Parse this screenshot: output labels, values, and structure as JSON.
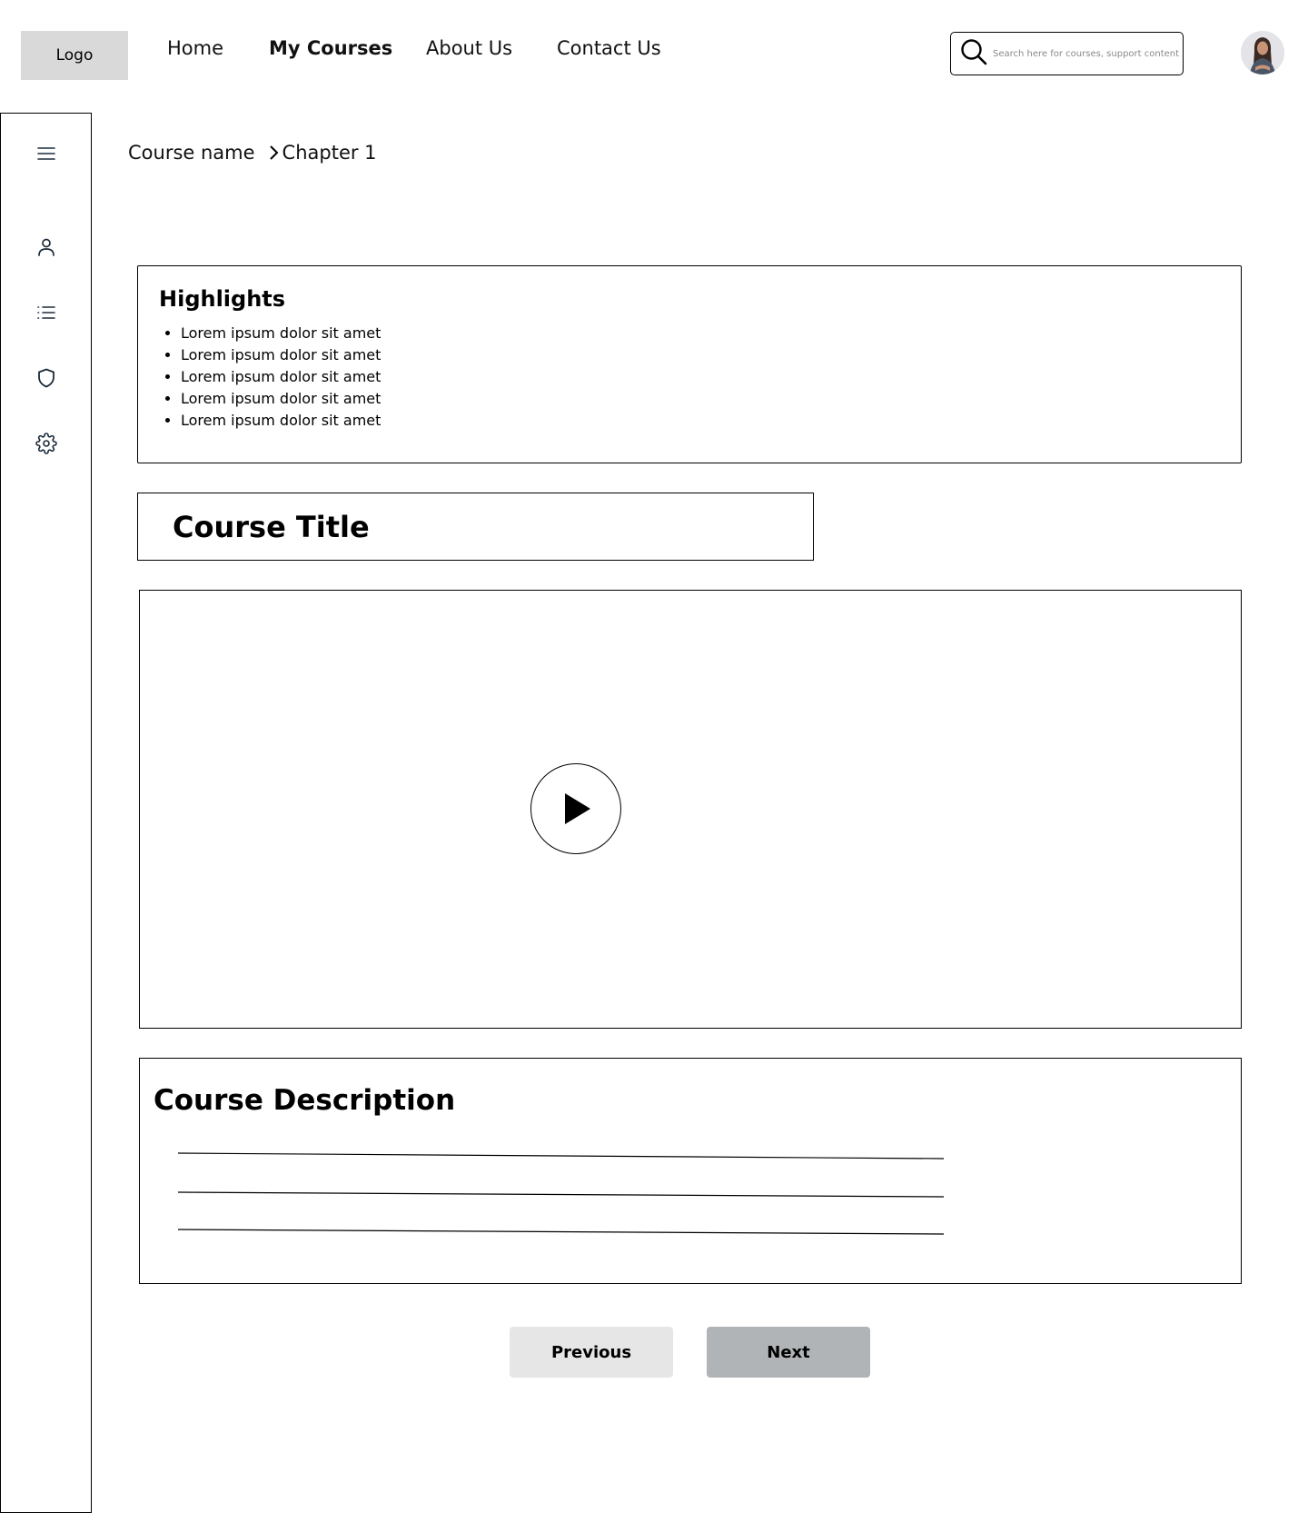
{
  "header": {
    "logo_label": "Logo",
    "nav": [
      {
        "label": "Home",
        "active": false
      },
      {
        "label": "My Courses",
        "active": true
      },
      {
        "label": "About Us",
        "active": false
      },
      {
        "label": "Contact Us",
        "active": false
      }
    ],
    "search": {
      "placeholder": "Search here for courses, support content",
      "value": ""
    },
    "avatar_icon": "user-avatar"
  },
  "sidebar": {
    "icons": [
      "menu-icon",
      "user-icon",
      "list-icon",
      "shield-icon",
      "gear-icon"
    ],
    "accent_color": "#1b2b3a"
  },
  "breadcrumb": {
    "course": "Course name",
    "chapter": "Chapter 1"
  },
  "highlights": {
    "title": "Highlights",
    "items": [
      "Lorem ipsum dolor sit amet",
      "Lorem ipsum dolor sit amet",
      "Lorem ipsum dolor sit amet",
      "Lorem ipsum dolor sit amet",
      "Lorem ipsum dolor sit amet"
    ]
  },
  "course": {
    "title": "Course Title"
  },
  "video": {
    "icon": "play-icon"
  },
  "description": {
    "title": "Course Description"
  },
  "pagination": {
    "previous_label": "Previous",
    "next_label": "Next",
    "previous_bg": "#e6e6e6",
    "next_bg": "#b0b4b6"
  }
}
